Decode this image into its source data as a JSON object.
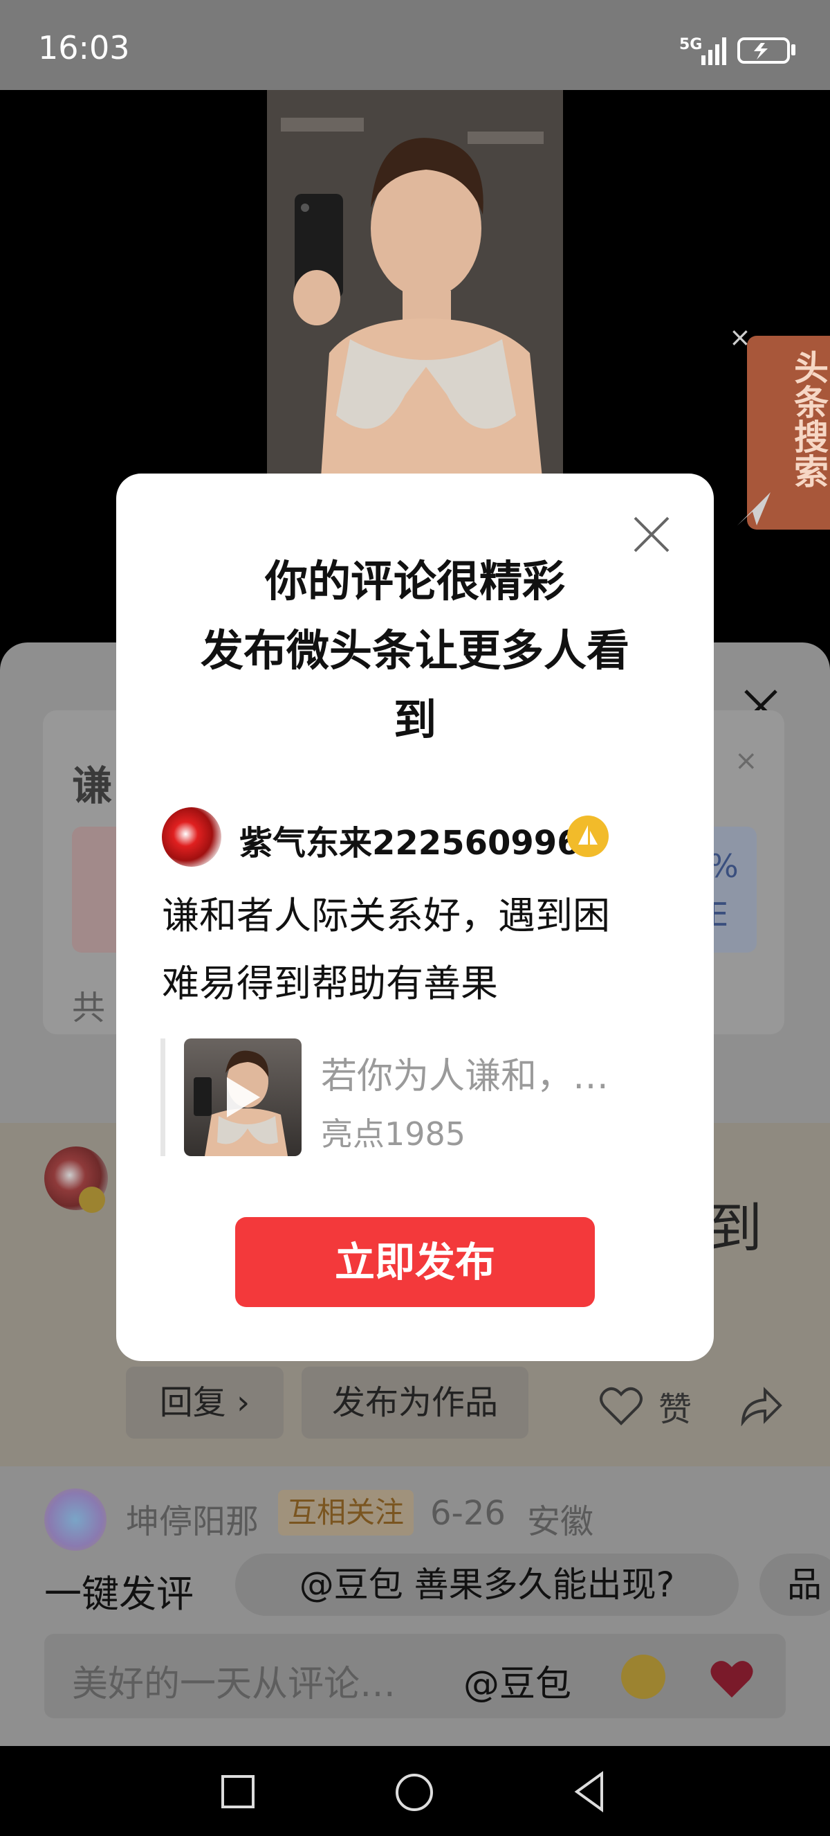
{
  "status_bar": {
    "time": "16:03",
    "network": "5G"
  },
  "side_search": {
    "label": "头条搜索"
  },
  "sheet": {
    "card_title_partial": "谦",
    "card_footer_partial": "共",
    "card_pct_partial": "%",
    "card_more_partial": "E",
    "comment_tail": "到",
    "reply_button": "回复 ›",
    "publish_as_work_button": "发布为作品",
    "like_label": "赞",
    "next_comment": {
      "user": "坤停阳那",
      "relation": "互相关注",
      "date": "6-26",
      "location": "安徽"
    },
    "quick_label": "一键发评",
    "quick_chips": [
      "@豆包 善果多久能出现?",
      "品"
    ],
    "input_placeholder": "美好的一天从评论…",
    "input_mention": "@豆包"
  },
  "modal": {
    "title_lines": [
      "你的评论很精彩",
      "发布微头条让更多人看",
      "到"
    ],
    "username": "紫气东来222560996",
    "comment_lines": [
      "谦和者人际关系好，遇到困",
      "难易得到帮助有善果"
    ],
    "quote_title": "若你为人谦和，…",
    "quote_author": "亮点1985",
    "publish_button": "立即发布"
  },
  "colors": {
    "accent": "#f3393b",
    "badge": "#f2bb2a"
  }
}
